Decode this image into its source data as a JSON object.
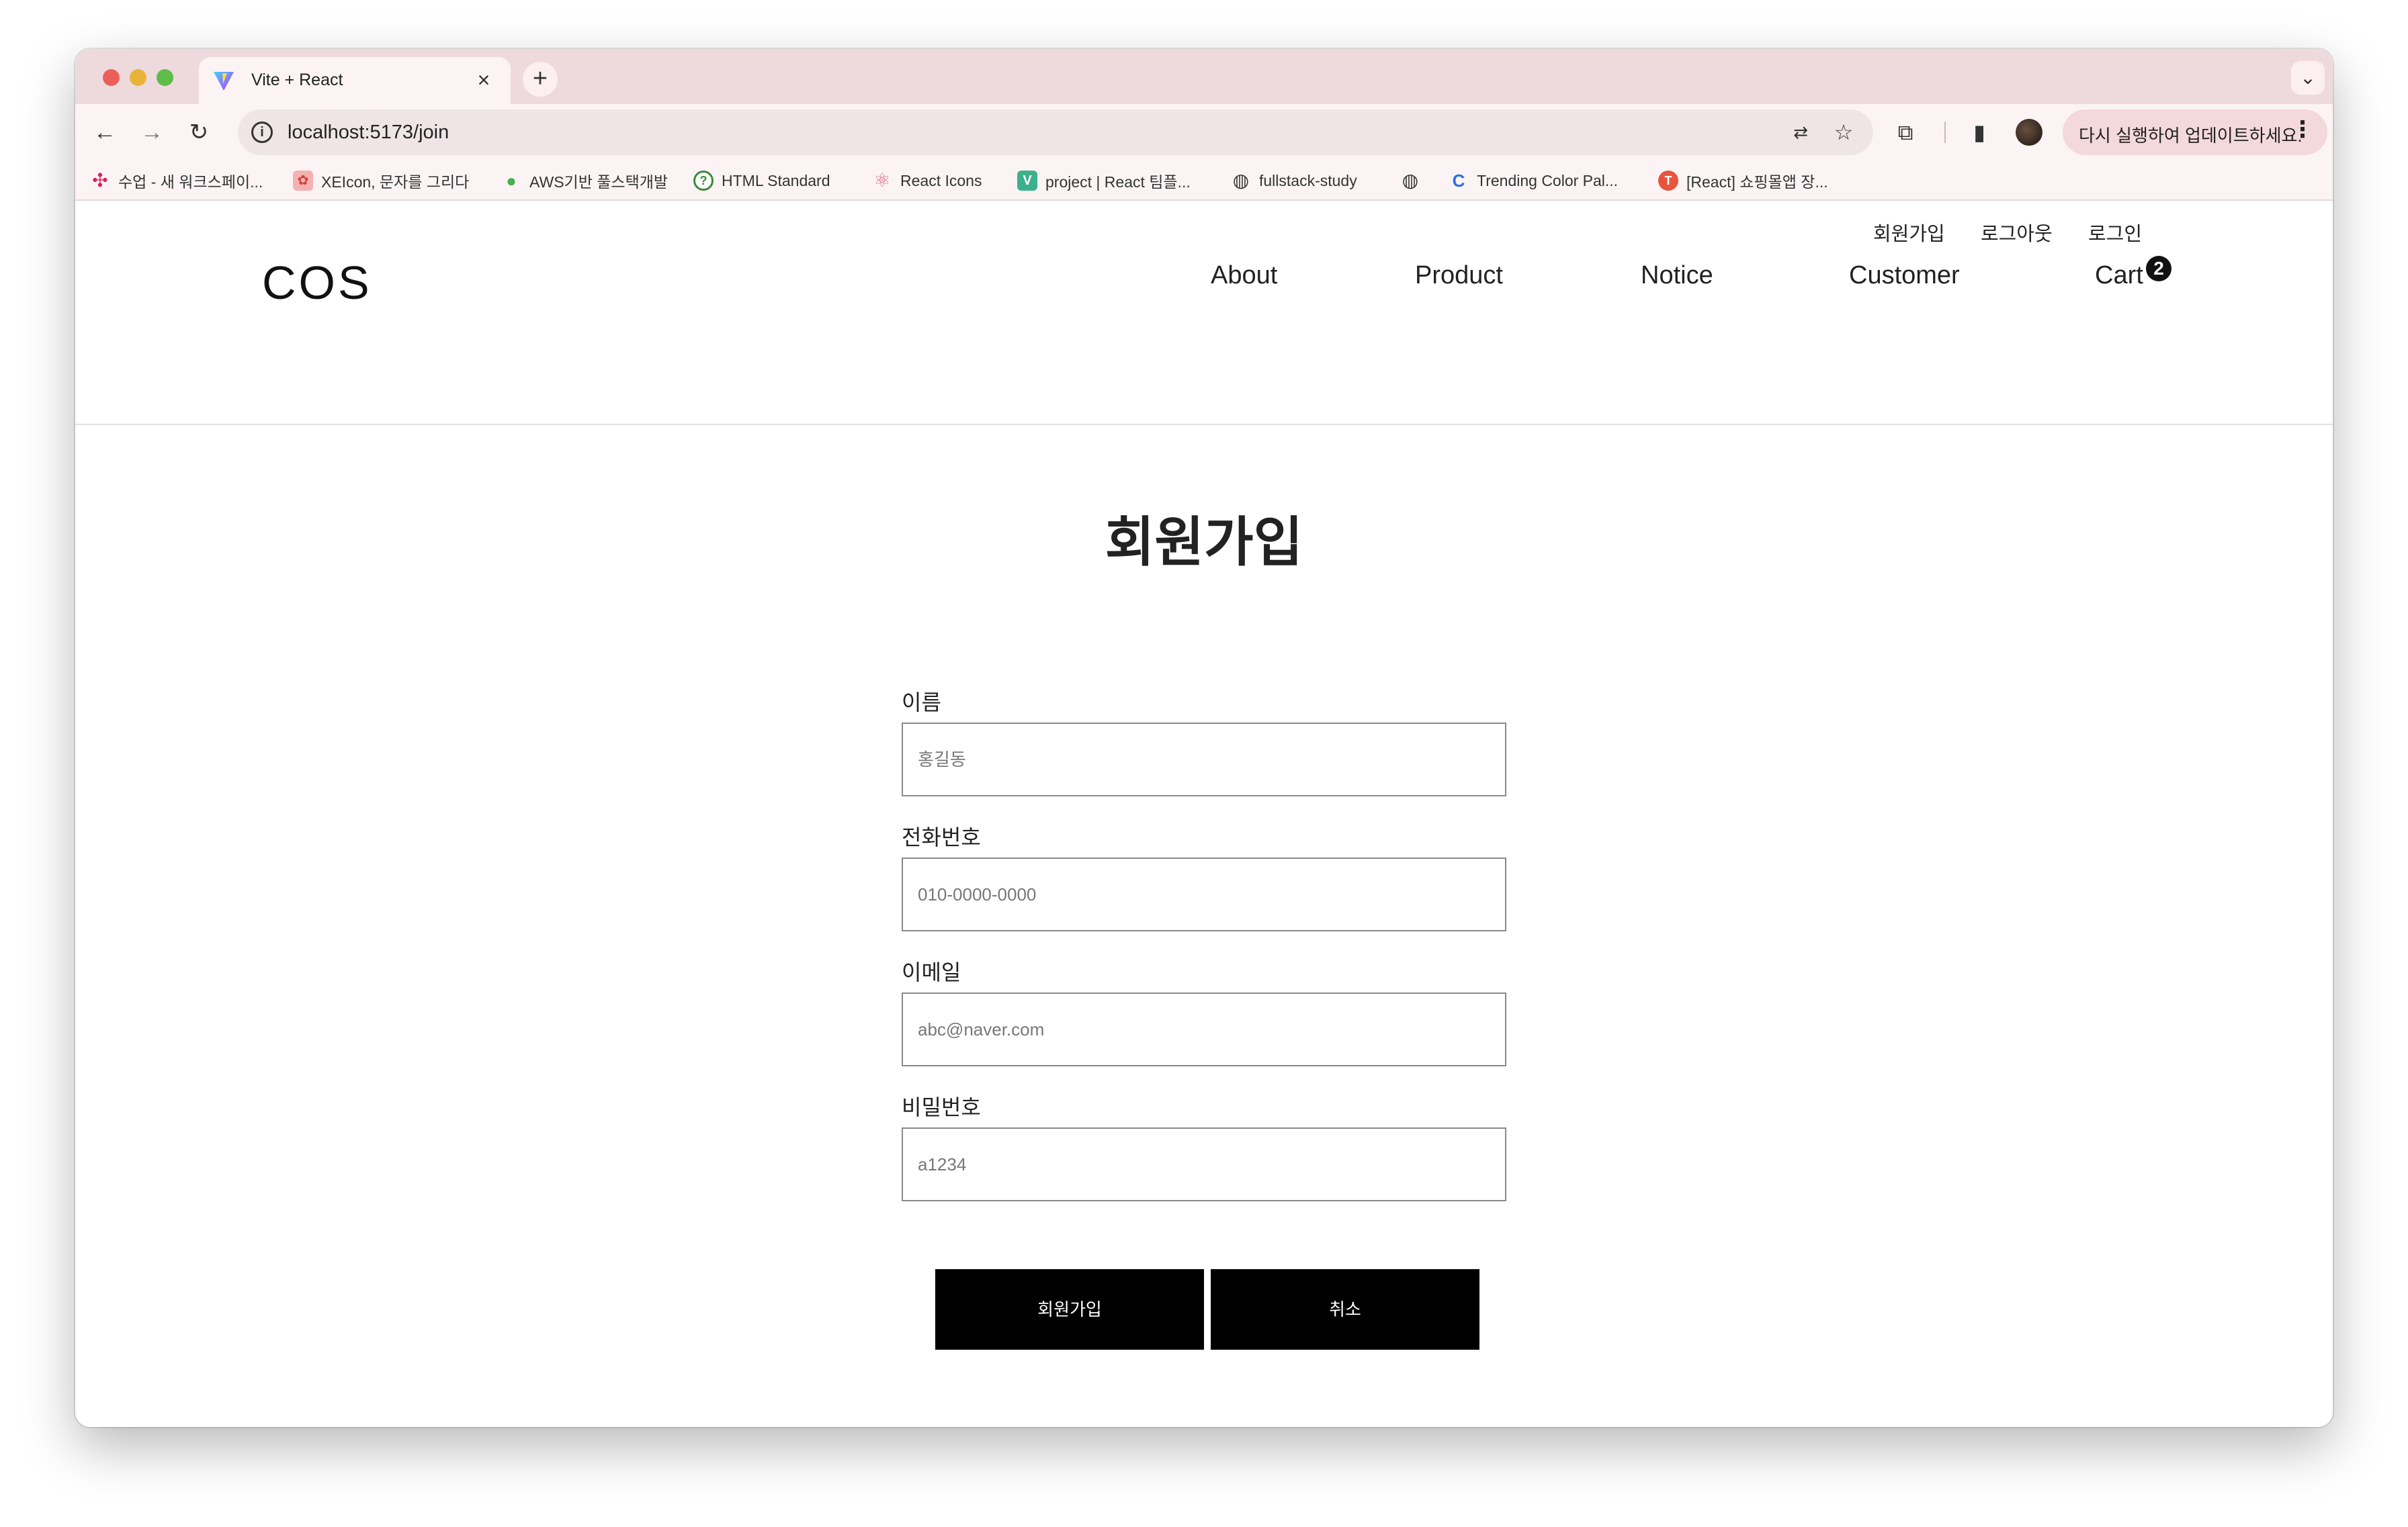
{
  "browser": {
    "tab_title": "Vite + React",
    "tab_close": "×",
    "new_tab": "+",
    "tab_menu": "⌄",
    "url": "localhost:5173/join",
    "update_button": "다시 실행하여 업데이트하세요.",
    "bookmarks": [
      {
        "label": "수업 - 새 워크스페이...",
        "icon": "slack-icon",
        "color": "#e01e5a"
      },
      {
        "label": "XEIcon, 문자를 그리다",
        "icon": "xeicon-icon",
        "color": "#f07070"
      },
      {
        "label": "AWS기반 풀스택개발",
        "icon": "leaf-icon",
        "color": "#4caf50"
      },
      {
        "label": "HTML Standard",
        "icon": "help-circle-icon",
        "color": "#3b8a3b"
      },
      {
        "label": "React Icons",
        "icon": "react-icon",
        "color": "#e06a8a"
      },
      {
        "label": "project | React 팀플...",
        "icon": "v-icon",
        "color": "#3cb08a"
      },
      {
        "label": "fullstack-study",
        "icon": "globe-icon",
        "color": "#333333"
      },
      {
        "label": "",
        "icon": "globe-icon",
        "color": "#333333"
      },
      {
        "label": "Trending Color Pal...",
        "icon": "c-icon",
        "color": "#2a6ee8"
      },
      {
        "label": "[React] 쇼핑몰앱 장...",
        "icon": "tistory-icon",
        "color": "#e8553e"
      }
    ]
  },
  "site": {
    "logo": "COS",
    "util_links": [
      "회원가입",
      "로그아웃",
      "로그인"
    ],
    "nav": [
      "About",
      "Product",
      "Notice",
      "Customer",
      "Cart"
    ],
    "cart_count": "2"
  },
  "form": {
    "title": "회원가입",
    "fields": [
      {
        "label": "이름",
        "placeholder": "홍길동"
      },
      {
        "label": "전화번호",
        "placeholder": "010-0000-0000"
      },
      {
        "label": "이메일",
        "placeholder": "abc@naver.com"
      },
      {
        "label": "비밀번호",
        "placeholder": "a1234"
      }
    ],
    "submit_label": "회원가입",
    "cancel_label": "취소"
  }
}
